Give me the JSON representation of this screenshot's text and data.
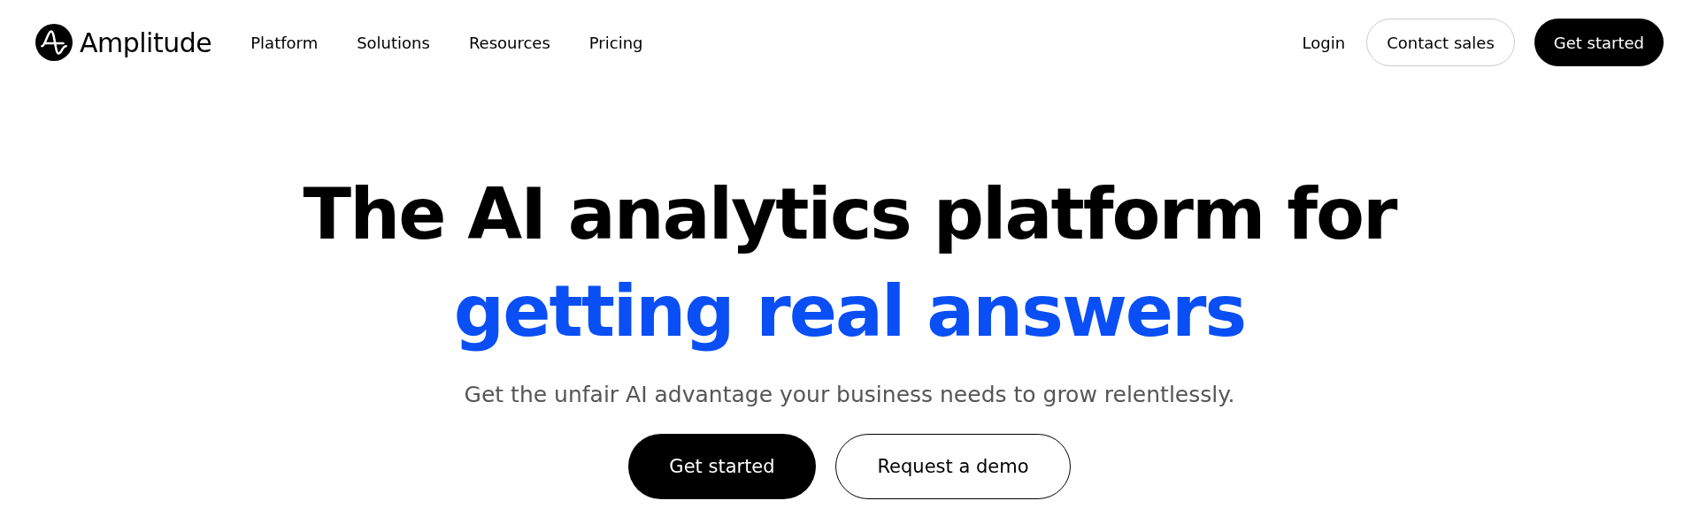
{
  "header": {
    "logo": "Amplitude",
    "nav": [
      {
        "label": "Platform"
      },
      {
        "label": "Solutions"
      },
      {
        "label": "Resources"
      },
      {
        "label": "Pricing"
      }
    ],
    "actions": [
      {
        "label": "Login",
        "kind": "link"
      },
      {
        "label": "Contact sales",
        "kind": "outline"
      },
      {
        "label": "Get started",
        "kind": "solid"
      }
    ]
  },
  "hero": {
    "title": "The AI analytics platform for",
    "highlight": "getting real answers",
    "subtitle": "Get the unfair AI advantage your business needs to grow relentlessly.",
    "buttons": [
      {
        "label": "Get started",
        "kind": "solid"
      },
      {
        "label": "Request a demo",
        "kind": "outline"
      }
    ]
  }
}
